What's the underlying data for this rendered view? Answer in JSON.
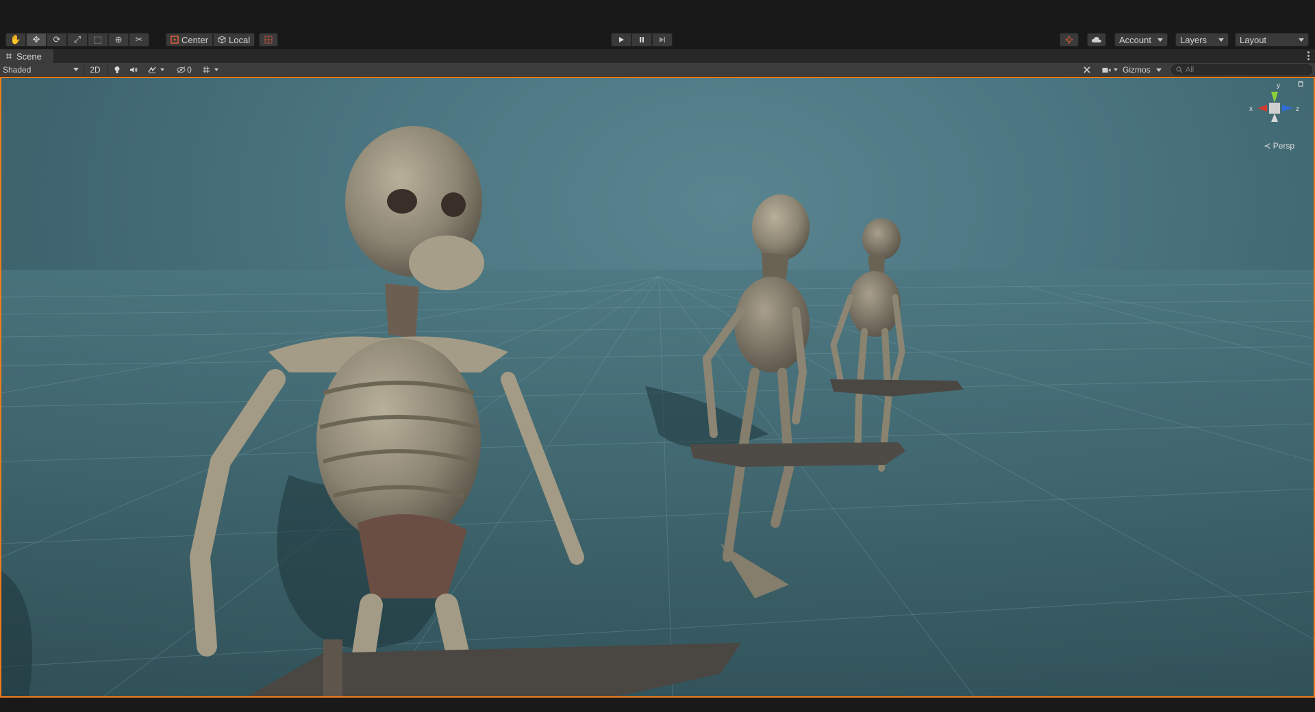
{
  "toolbar": {
    "tools": [
      {
        "icon": "hand-tool-icon",
        "glyph": "✋"
      },
      {
        "icon": "move-tool-icon",
        "glyph": "✥"
      },
      {
        "icon": "rotate-tool-icon",
        "glyph": "⟳"
      },
      {
        "icon": "scale-tool-icon",
        "glyph": "⤢"
      },
      {
        "icon": "rect-tool-icon",
        "glyph": "⬚"
      },
      {
        "icon": "transform-tool-icon",
        "glyph": "⊕"
      },
      {
        "icon": "custom-tool-icon",
        "glyph": "✂"
      }
    ],
    "pivot_center_label": "Center",
    "pivot_local_label": "Local",
    "account_label": "Account",
    "layers_label": "Layers",
    "layout_label": "Layout"
  },
  "tab": {
    "title": "Scene"
  },
  "scene_bar": {
    "draw_mode": "Shaded",
    "mode_2d_label": "2D",
    "hidden_count": "0",
    "gizmos_label": "Gizmos",
    "search_placeholder": "All"
  },
  "viewport": {
    "projection_label": "Persp",
    "axis_y": "y",
    "axis_x": "x",
    "axis_z": "z"
  },
  "colors": {
    "selection_outline": "#f07d1a",
    "panel_bg": "#3c3c3c",
    "editor_bg": "#191919",
    "sky_teal": "#4b7580"
  }
}
